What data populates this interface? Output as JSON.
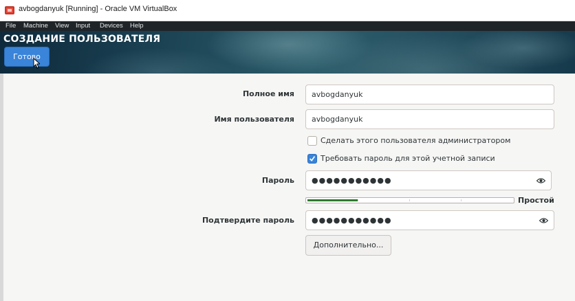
{
  "titlebar": {
    "title": "avbogdanyuk [Running] - Oracle VM VirtualBox"
  },
  "menubar": {
    "items": [
      "File",
      "Machine",
      "View",
      "Input",
      "Devices",
      "Help"
    ]
  },
  "header": {
    "title": "СОЗДАНИЕ ПОЛЬЗОВАТЕЛЯ",
    "done_label": "Готово"
  },
  "form": {
    "fullname_label": "Полное имя",
    "fullname_value": "avbogdanyuk",
    "username_label": "Имя пользователя",
    "username_value": "avbogdanyuk",
    "admin_checkbox": {
      "label": "Сделать этого пользователя администратором",
      "checked": false
    },
    "require_password_checkbox": {
      "label": "Требовать пароль для этой учетной записи",
      "checked": true
    },
    "password_label": "Пароль",
    "password_mask": "●●●●●●●●●●●",
    "strength_label": "Простой",
    "strength_fraction": 0.25,
    "confirm_label": "Подтвердите пароль",
    "confirm_mask": "●●●●●●●●●●●",
    "advanced_label": "Дополнительно..."
  },
  "colors": {
    "accent": "#3a84d9",
    "strength_bar": "#2f7a2f",
    "menubar_bg": "#1f2428"
  },
  "icons": {
    "app": "virtualbox-icon",
    "reveal": "eye-icon",
    "check": "checkmark-icon",
    "pointer": "cursor-icon"
  }
}
